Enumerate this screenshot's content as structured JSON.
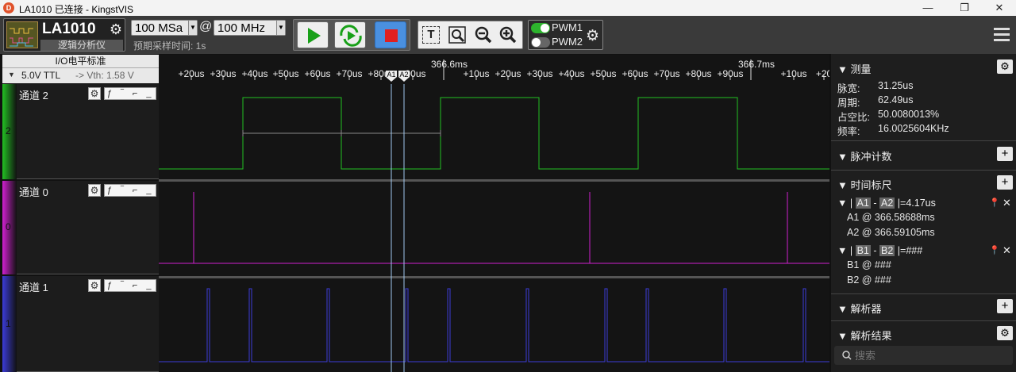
{
  "window": {
    "title": "LA1010 已连接 - KingstVIS",
    "minimize": "—",
    "maximize": "❐",
    "close": "✕"
  },
  "toolbar": {
    "device_name": "LA1010",
    "device_subtitle": "逻辑分析仪",
    "sample_depth": "100 MSa",
    "at": "@",
    "sample_rate": "100 MHz",
    "estimate_time": "预期采样时间: 1s",
    "pwm1": "PWM1",
    "pwm2": "PWM2",
    "menu_icon": "hamburger-icon",
    "text_icon_label": "T"
  },
  "io_panel": {
    "title": "I/O电平标准",
    "level": "5.0V TTL",
    "vth": "-> Vth: 1.58 V"
  },
  "ruler": {
    "ticks": [
      "+20us",
      "+30us",
      "+40us",
      "+50us",
      "+60us",
      "+70us",
      "+80us",
      "+90us",
      "+10us",
      "+20us",
      "+30us",
      "+40us",
      "+50us",
      "+60us",
      "+70us",
      "+80us",
      "+90us",
      "+10us",
      "+20"
    ],
    "major": [
      "366.6ms",
      "366.7ms"
    ],
    "marker_a1": "A1",
    "marker_a2": "A2"
  },
  "channels": [
    {
      "name": "通道 2",
      "index": "2",
      "color": "#22c022",
      "trigger": "ƒ ‾ ⌐ _"
    },
    {
      "name": "通道 0",
      "index": "0",
      "color": "#d020d0",
      "trigger": "ƒ ‾ ⌐ _"
    },
    {
      "name": "通道 1",
      "index": "1",
      "color": "#3b3bd8",
      "trigger": "ƒ ‾ ⌐ _"
    }
  ],
  "right_panel": {
    "measure_title": "测量",
    "measure": [
      {
        "label": "脉宽:",
        "value": "31.25us"
      },
      {
        "label": "周期:",
        "value": "62.49us"
      },
      {
        "label": "占空比:",
        "value": "50.0080013%"
      },
      {
        "label": "频率:",
        "value": "16.0025604KHz"
      }
    ],
    "pulse_count_title": "脉冲计数",
    "timing_title": "时间标尺",
    "a_pair": {
      "a": "A1",
      "b": "A2",
      "diff": "|=4.17us",
      "line1": "A1 @ 366.58688ms",
      "line2": "A2 @ 366.59105ms"
    },
    "b_pair": {
      "a": "B1",
      "b": "B2",
      "diff": "|=###",
      "line1": "B1 @ ###",
      "line2": "B2 @ ###"
    },
    "decoder_title": "解析器",
    "decoder_result_title": "解析结果",
    "search_placeholder": "搜索"
  }
}
